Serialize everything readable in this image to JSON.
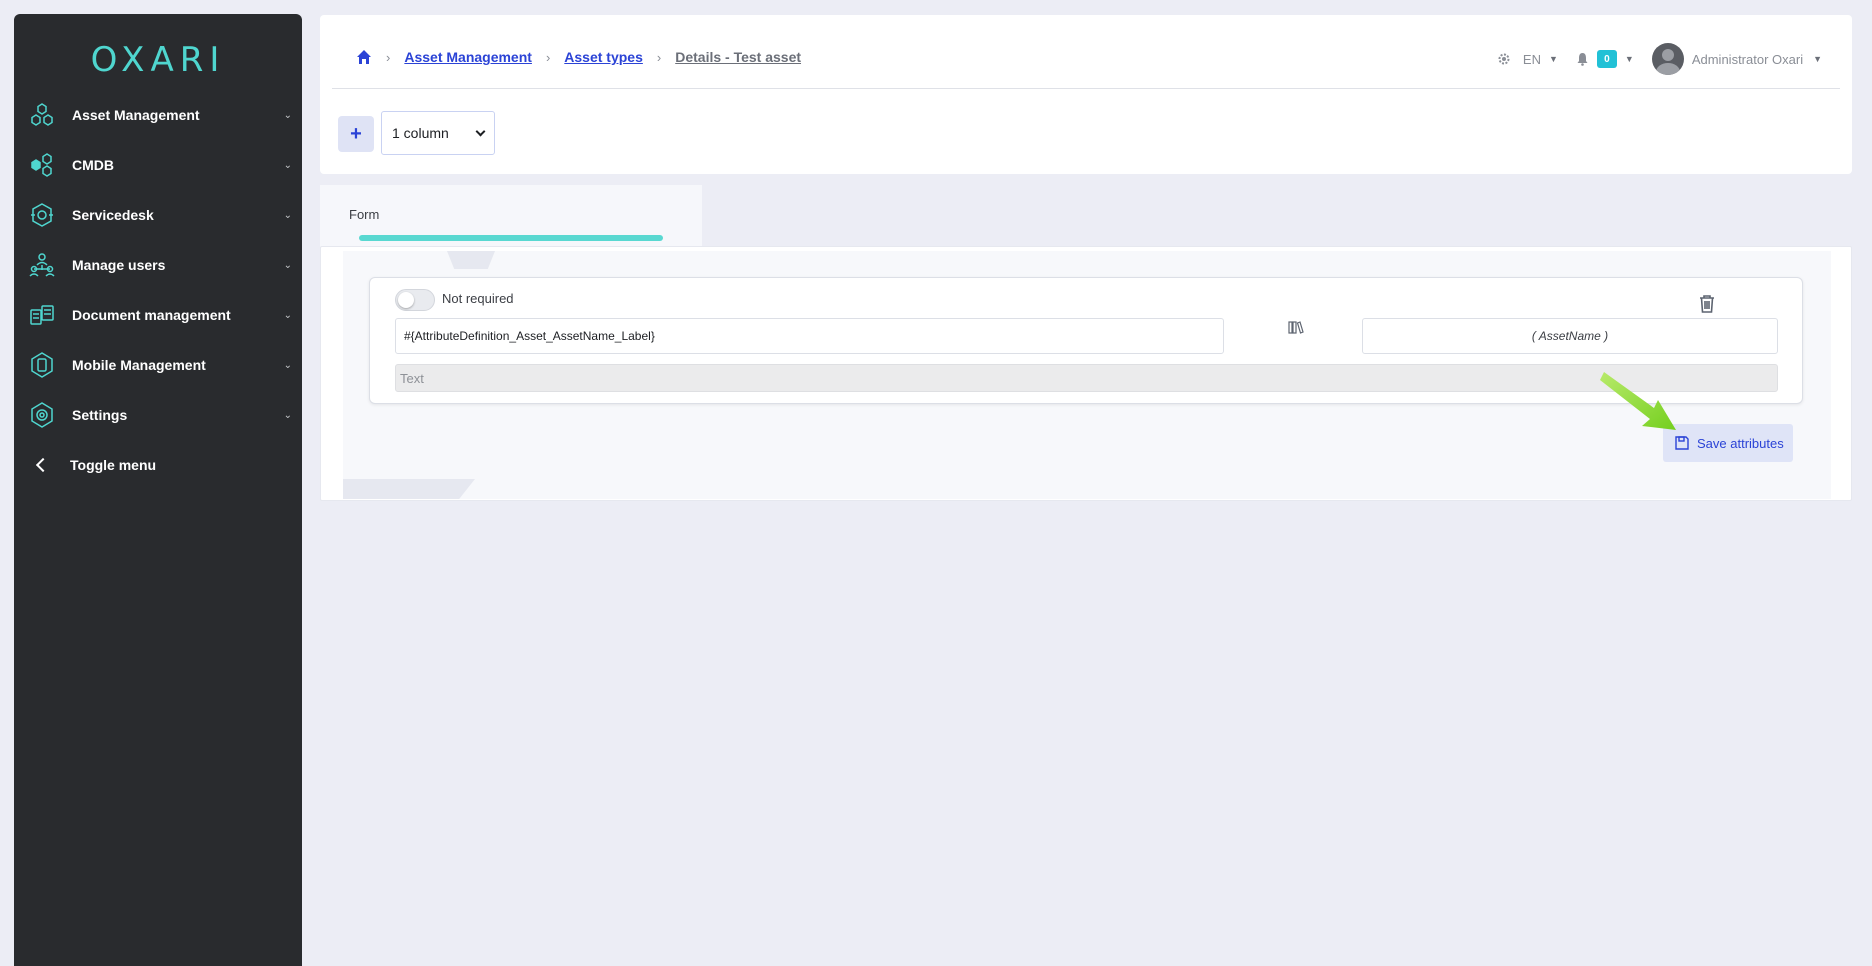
{
  "sidebar": {
    "logo": "OXARI",
    "items": [
      {
        "label": "Asset Management",
        "icon": "hexagon-cluster-icon"
      },
      {
        "label": "CMDB",
        "icon": "cmdb-hex-icon"
      },
      {
        "label": "Servicedesk",
        "icon": "servicedesk-icon"
      },
      {
        "label": "Manage users",
        "icon": "users-tree-icon"
      },
      {
        "label": "Document management",
        "icon": "documents-icon"
      },
      {
        "label": "Mobile Management",
        "icon": "mobile-hex-icon"
      },
      {
        "label": "Settings",
        "icon": "settings-gear-icon"
      }
    ],
    "toggle_label": "Toggle menu"
  },
  "header": {
    "breadcrumb": {
      "items": [
        "Asset Management",
        "Asset types"
      ],
      "current": "Details - Test asset"
    },
    "language": "EN",
    "notifications": "0",
    "user": "Administrator Oxari",
    "add_label": "+",
    "columns_select": "1 column"
  },
  "tabs": {
    "form_label": "Form"
  },
  "attribute": {
    "toggle_label": "Not required",
    "label_value": "#{AttributeDefinition_Asset_AssetName_Label}",
    "name_value": "( AssetName )",
    "type_placeholder": "Text"
  },
  "actions": {
    "save_label": "Save attributes"
  },
  "colors": {
    "sidebar_bg": "#292b2e",
    "accent_teal": "#4fd6cf",
    "link_blue": "#2b43d6",
    "arrow_green": "#7ed321"
  }
}
